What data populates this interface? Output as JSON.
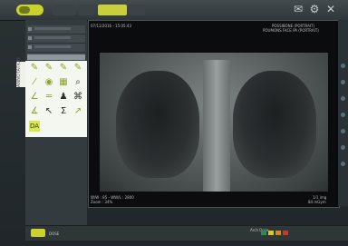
{
  "topbar": {
    "icons": [
      "mail-icon",
      "settings-icon",
      "close-icon"
    ],
    "buttons": [
      {
        "label": "",
        "icon": "menu-icon"
      },
      {
        "label": "",
        "icon": "car-icon"
      },
      {
        "label": "",
        "icon": "calendar-icon"
      },
      {
        "label": "",
        "icon": "eye-icon"
      }
    ]
  },
  "left_panel": {
    "rows": [
      "",
      "",
      "",
      ""
    ],
    "tab_label": "ANNOTATION"
  },
  "tools": [
    "pencil",
    "pencil",
    "pencil",
    "pencil",
    "circle",
    "circle",
    "circle",
    "circle",
    "angle",
    "ruler",
    "person",
    "window",
    "angle",
    "pointer",
    "text",
    "arrow",
    "DA"
  ],
  "viewer": {
    "header_left": "07/11/2016 - 15:05:43",
    "header_right_1": "POSSIBONE (PORTRAIT)",
    "header_right_2": "POUMONS FACE PA (PORTRAIT)",
    "footer_left_1": "W/W : 85 - WW/L : 2800",
    "footer_left_2": "Zoom : 34%",
    "footer_right_1": "1/1 img",
    "footer_right_2": "84 mGym"
  },
  "bottom": {
    "left_text": "DOSE",
    "right_text": "Arch Dose"
  },
  "colors": {
    "accent": "#c9d32a",
    "tool_icon": "#8aa52a",
    "tool_bg": "#f4f6f0",
    "selected": "#d6e84a"
  }
}
